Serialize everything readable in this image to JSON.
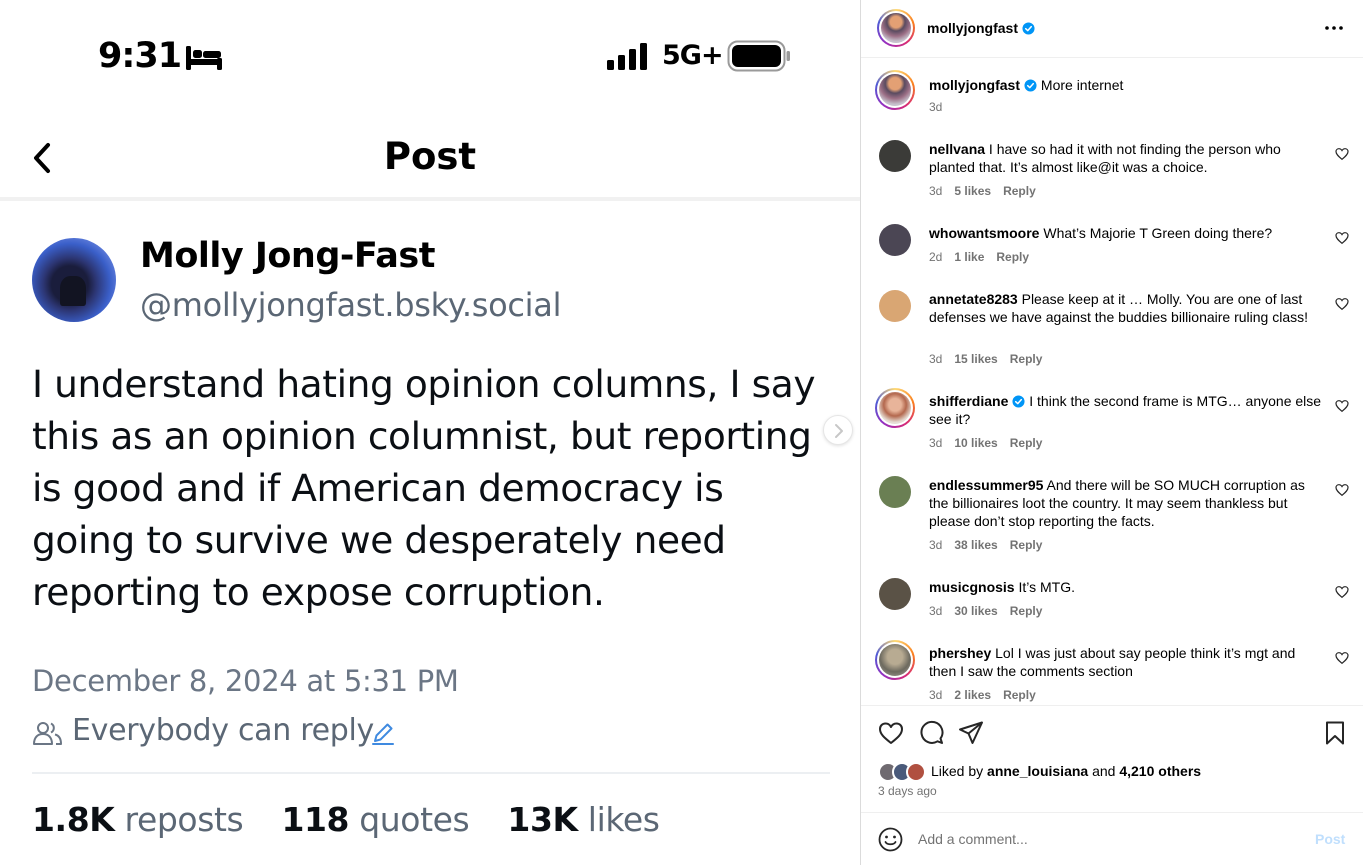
{
  "bsky": {
    "status_bar": {
      "time": "9:31",
      "network": "5G+"
    },
    "header": {
      "title": "Post"
    },
    "author": {
      "name": "Molly Jong-Fast",
      "handle": "@mollyjongfast.bsky.social"
    },
    "body_lines": [
      "I understand hating opinion columns, I say",
      "this as an opinion columnist, but reporting",
      "is good and if American democracy is",
      "going to survive we desperately need",
      "reporting to expose corruption."
    ],
    "timestamp": "December 8, 2024 at 5:31 PM",
    "reply_setting": "Everybody can reply",
    "stats": {
      "reposts_count": "1.8K",
      "reposts_label": "reposts",
      "quotes_count": "118",
      "quotes_label": "quotes",
      "likes_count": "13K",
      "likes_label": "likes"
    }
  },
  "instagram": {
    "header": {
      "username": "mollyjongfast",
      "verified": true
    },
    "caption": {
      "username": "mollyjongfast",
      "text": "More internet",
      "time": "3d"
    },
    "reply_label": "Reply",
    "comments": [
      {
        "username": "nellvana",
        "text": "I have so had it with not finding the person who planted that. It’s almost like@it was a choice.",
        "time": "3d",
        "likes": "5 likes",
        "avatar_color": "#3b3b38"
      },
      {
        "username": "whowantsmoore",
        "text": "What’s Majorie T Green doing there?",
        "time": "2d",
        "likes": "1 like",
        "avatar_color": "#4b4654"
      },
      {
        "username": "annetate8283",
        "text": "Please keep at it … Molly. You are one of last defenses we have against the buddies billionaire ruling class!",
        "time": "3d",
        "likes": "15 likes",
        "avatar_color": "#d9a673"
      },
      {
        "username": "shifferdiane",
        "verified": true,
        "text": "I think the second frame is MTG… anyone else see it?",
        "time": "3d",
        "likes": "10 likes",
        "avatar_color": "#c58d7a"
      },
      {
        "username": "endlessummer95",
        "text": "And there will be SO MUCH corruption as the billionaires loot the country. It may seem thankless but please don’t stop reporting the facts.",
        "time": "3d",
        "likes": "38 likes",
        "avatar_color": "#6a7f53"
      },
      {
        "username": "musicgnosis",
        "text": "It’s MTG.",
        "time": "3d",
        "likes": "30 likes",
        "avatar_color": "#5a5246"
      },
      {
        "username": "phershey",
        "text": "Lol I was just about say people think it’s mgt and then I saw the comments section",
        "time": "3d",
        "likes": "2 likes",
        "avatar_color": "#8d8a82"
      }
    ],
    "liked_by": {
      "prefix": "Liked by",
      "user": "anne_louisiana",
      "and": "and",
      "others": "4,210 others"
    },
    "time_ago": "3 days ago",
    "comment_box": {
      "placeholder": "Add a comment...",
      "post_label": "Post"
    },
    "colors": {
      "muted": "#737373",
      "post_disabled": "#c0dffd",
      "verified": "#0095f6"
    }
  }
}
